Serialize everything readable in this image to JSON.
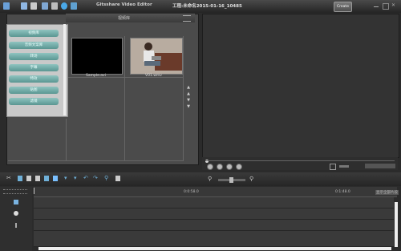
{
  "window": {
    "app_title": "Gitsshare Video Editor",
    "project_name": "工程:未命名2015-01-16_10485",
    "create_label": "Create"
  },
  "media_panel": {
    "header_title": "视频库",
    "sidebar_items": [
      "视频库",
      "音频文案库",
      "转场",
      "字幕",
      "特效",
      "贴图",
      "滤镜"
    ],
    "thumbnails": [
      {
        "caption": "Sample.avi"
      },
      {
        "caption": "V01.wmv"
      }
    ]
  },
  "timeline": {
    "ruler_labels": [
      "0:0:58.0",
      "0:1:48.0"
    ],
    "zoom_label": "显示全部片段"
  },
  "colors": {
    "accent_teal": "#6fb0ab",
    "panel_bg": "#4b4b4b",
    "preview_bg": "#333333"
  }
}
